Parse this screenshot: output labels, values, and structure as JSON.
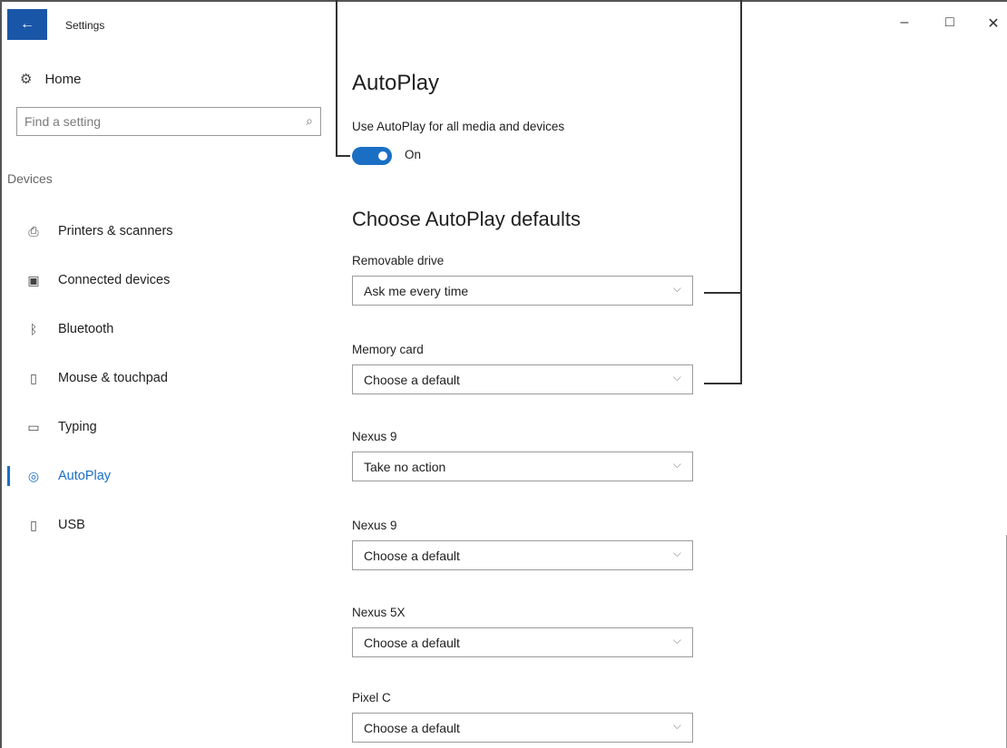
{
  "window": {
    "title": "Settings",
    "back_glyph": "←",
    "minimize_glyph": "–",
    "maximize_glyph": "□",
    "close_glyph": "✕"
  },
  "sidebar": {
    "home_label": "Home",
    "search_placeholder": "Find a setting",
    "section_label": "Devices",
    "items": [
      {
        "label": "Printers & scanners",
        "icon": "printer-icon",
        "glyph": "⎙"
      },
      {
        "label": "Connected devices",
        "icon": "connected-devices-icon",
        "glyph": "▣"
      },
      {
        "label": "Bluetooth",
        "icon": "bluetooth-icon",
        "glyph": "ᛒ"
      },
      {
        "label": "Mouse & touchpad",
        "icon": "mouse-icon",
        "glyph": "▯"
      },
      {
        "label": "Typing",
        "icon": "keyboard-icon",
        "glyph": "▭"
      },
      {
        "label": "AutoPlay",
        "icon": "autoplay-icon",
        "glyph": "◎",
        "active": true
      },
      {
        "label": "USB",
        "icon": "usb-icon",
        "glyph": "▯"
      }
    ]
  },
  "main": {
    "title": "AutoPlay",
    "toggle_label": "Use AutoPlay for all media and devices",
    "toggle_state": "On",
    "defaults_title": "Choose AutoPlay defaults",
    "devices": [
      {
        "label": "Removable drive",
        "value": "Ask me every time"
      },
      {
        "label": "Memory card",
        "value": "Choose a default"
      },
      {
        "label": "Nexus 9",
        "value": "Take no action"
      },
      {
        "label": "Nexus 9",
        "value": "Choose a default"
      },
      {
        "label": "Nexus 5X",
        "value": "Choose a default"
      },
      {
        "label": "Pixel C",
        "value": "Choose a default"
      }
    ]
  },
  "colors": {
    "accent": "#1a6fc4",
    "title_bar_back": "#1a56a8"
  }
}
